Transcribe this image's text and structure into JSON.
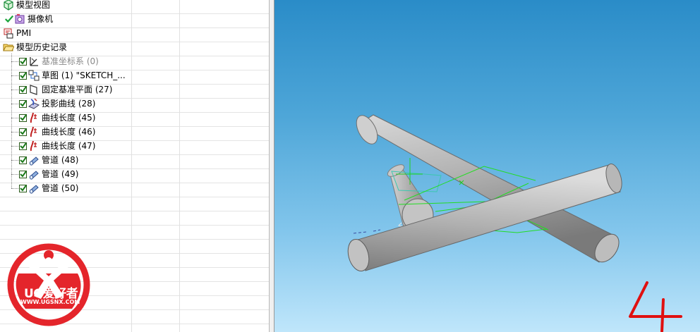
{
  "part_navigator": {
    "nodes": [
      {
        "label": "模型视图",
        "icon": "model-views-icon"
      },
      {
        "label": "摄像机",
        "icon": "cameras-icon",
        "checked": true
      },
      {
        "label": "PMI",
        "icon": "pmi-icon"
      },
      {
        "label": "模型历史记录",
        "icon": "folder-open-icon",
        "expanded": true
      },
      {
        "label": "基准坐标系 (0)",
        "icon": "datum-csys-icon",
        "checked": true,
        "dimmed": true
      },
      {
        "label": "草图 (1) \"SKETCH_...",
        "icon": "sketch-icon",
        "checked": true
      },
      {
        "label": "固定基准平面 (27)",
        "icon": "datum-plane-icon",
        "checked": true
      },
      {
        "label": "投影曲线 (28)",
        "icon": "projected-curve-icon",
        "checked": true
      },
      {
        "label": "曲线长度 (45)",
        "icon": "curve-length-icon",
        "checked": true
      },
      {
        "label": "曲线长度 (46)",
        "icon": "curve-length-icon",
        "checked": true
      },
      {
        "label": "曲线长度 (47)",
        "icon": "curve-length-icon",
        "checked": true
      },
      {
        "label": "管道 (48)",
        "icon": "tube-icon",
        "checked": true
      },
      {
        "label": "管道 (49)",
        "icon": "tube-icon",
        "checked": true
      },
      {
        "label": "管道 (50)",
        "icon": "tube-icon",
        "checked": true
      }
    ]
  },
  "watermark": {
    "brand": "UG爱好者",
    "url": "WWW.UGSNX.COM"
  },
  "viewport": {
    "annotation": "4"
  },
  "colors": {
    "viewport_top": "#2a8cc8",
    "viewport_bottom": "#bfe6fb",
    "tube": "#b8b8b8",
    "curve": "#22dd22",
    "annotation": "#e01010",
    "watermark": "#e4252b"
  }
}
